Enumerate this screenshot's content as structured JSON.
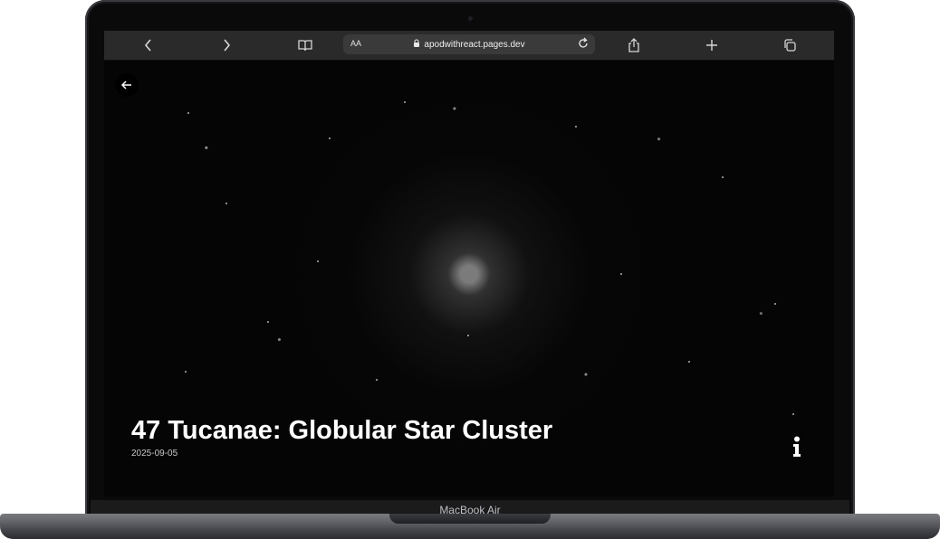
{
  "device": {
    "label": "MacBook Air"
  },
  "browser": {
    "toolbar": {
      "reader_text_label": "AA",
      "address_url": "apodwithreact.pages.dev",
      "icons": {
        "back": "chevron-left-icon",
        "forward": "chevron-right-icon",
        "reader": "book-icon",
        "lock": "lock-icon",
        "reload": "reload-icon",
        "share": "share-icon",
        "new_tab": "plus-icon",
        "tabs": "tabs-icon"
      }
    }
  },
  "page": {
    "back_button_icon": "back-arrow-icon",
    "title": "47 Tucanae: Globular Star Cluster",
    "date": "2025-09-05",
    "info_button_icon": "info-icon",
    "colors": {
      "background": "#050505",
      "title_text": "#ffffff",
      "date_text": "#c8c8c8"
    }
  }
}
